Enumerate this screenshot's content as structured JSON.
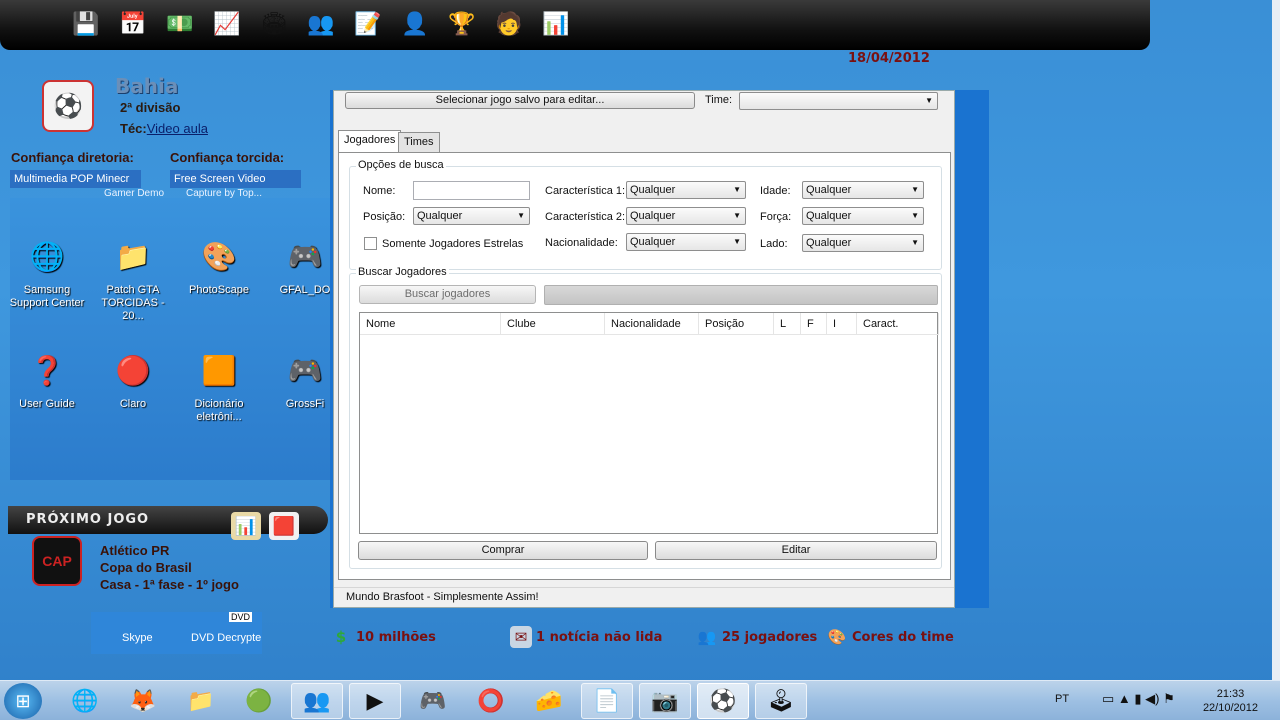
{
  "app": {
    "date": "18/04/2012"
  },
  "toolbar": {
    "icons": [
      {
        "name": "save-icon",
        "glyph": "💾"
      },
      {
        "name": "calendar-icon",
        "glyph": "📅"
      },
      {
        "name": "money-icon",
        "glyph": "💵"
      },
      {
        "name": "chart-icon",
        "glyph": "📈"
      },
      {
        "name": "stadium-icon",
        "glyph": "🏟"
      },
      {
        "name": "players-icon",
        "glyph": "👥"
      },
      {
        "name": "contract-icon",
        "glyph": "📝"
      },
      {
        "name": "coach-icon",
        "glyph": "👤"
      },
      {
        "name": "trophy-icon",
        "glyph": "🏆"
      },
      {
        "name": "staff-icon",
        "glyph": "🧑"
      },
      {
        "name": "ranking-icon",
        "glyph": "📊"
      }
    ]
  },
  "club": {
    "name": "Bahia",
    "division": "2ª divisão",
    "tec_label": "Téc:",
    "tec_link": "Video aula",
    "confianca_diretoria": "Confiança diretoria:",
    "confianca_torcida": "Confiança torcida:",
    "bar1_text": "Multimedia POP",
    "bar1_text2": "Minecr",
    "bar1_sub": "Gamer Demo",
    "bar2_text": "Free Screen Video",
    "bar2_sub": "Capture by Top..."
  },
  "desktop": {
    "icons": [
      {
        "label": "Samsung Support Center",
        "glyph": "🌐"
      },
      {
        "label": "Patch GTA TORCIDAS - 20...",
        "glyph": "📁"
      },
      {
        "label": "PhotoScape",
        "glyph": "🎨"
      },
      {
        "label": "GFAL_DO",
        "glyph": "🎮"
      },
      {
        "label": "User Guide",
        "glyph": "❓"
      },
      {
        "label": "Claro",
        "glyph": "🔴"
      },
      {
        "label": "Dicionário eletrôni...",
        "glyph": "🟧"
      },
      {
        "label": "GrossFi",
        "glyph": "🎮"
      }
    ]
  },
  "next_match": {
    "header": "PRÓXIMO JOGO",
    "opponent": "Atlético PR",
    "competition": "Copa do Brasil",
    "detail": "Casa - 1ª fase - 1º jogo",
    "opp_logo_text": "CAP"
  },
  "bottom_desktop": {
    "skype": "Skype",
    "dvd": "DVD Decrypte",
    "dvd_badge": "DVD"
  },
  "status": {
    "money": "10 milhões",
    "news": "1 notícia não lida",
    "players": "25 jogadores",
    "colors": "Cores do time"
  },
  "dialog": {
    "select_saved_button": "Selecionar jogo salvo para editar...",
    "time_label": "Time:",
    "time_value": "",
    "tabs": [
      "Jogadores",
      "Times"
    ],
    "search_group_title": "Opções de busca",
    "nome_label": "Nome:",
    "nome_value": "",
    "posicao_label": "Posição:",
    "posicao_value": "Qualquer",
    "somente_estrelas": "Somente Jogadores Estrelas",
    "carac1_label": "Característica 1:",
    "carac1_value": "Qualquer",
    "carac2_label": "Característica 2:",
    "carac2_value": "Qualquer",
    "nacionalidade_label": "Nacionalidade:",
    "nacionalidade_value": "Qualquer",
    "idade_label": "Idade:",
    "idade_value": "Qualquer",
    "forca_label": "Força:",
    "forca_value": "Qualquer",
    "lado_label": "Lado:",
    "lado_value": "Qualquer",
    "buscar_group_title": "Buscar Jogadores",
    "buscar_button": "Buscar jogadores",
    "columns": [
      "Nome",
      "Clube",
      "Nacionalidade",
      "Posição",
      "L",
      "F",
      "I",
      "Caract."
    ],
    "comprar_button": "Comprar",
    "editar_button": "Editar",
    "status_text": "Mundo Brasfoot - Simplesmente Assim!"
  },
  "taskbar": {
    "apps": [
      {
        "name": "ie-icon",
        "glyph": "🌐",
        "state": ""
      },
      {
        "name": "firefox-icon",
        "glyph": "🦊",
        "state": ""
      },
      {
        "name": "explorer-icon",
        "glyph": "📁",
        "state": ""
      },
      {
        "name": "chrome-icon",
        "glyph": "🟢",
        "state": ""
      },
      {
        "name": "messenger-icon",
        "glyph": "👥",
        "state": "open"
      },
      {
        "name": "media-player-icon",
        "glyph": "▶",
        "state": "open"
      },
      {
        "name": "game-icon",
        "glyph": "🎮",
        "state": ""
      },
      {
        "name": "opera-icon",
        "glyph": "⭕",
        "state": ""
      },
      {
        "name": "cheese-icon",
        "glyph": "🧀",
        "state": ""
      },
      {
        "name": "note-icon",
        "glyph": "📄",
        "state": "open"
      },
      {
        "name": "camera-icon",
        "glyph": "📷",
        "state": "open"
      },
      {
        "name": "brasfoot-icon",
        "glyph": "⚽",
        "state": "active"
      },
      {
        "name": "controller-icon",
        "glyph": "🕹",
        "state": "open"
      }
    ],
    "lang": "PT",
    "time": "21:33",
    "date": "22/10/2012"
  }
}
